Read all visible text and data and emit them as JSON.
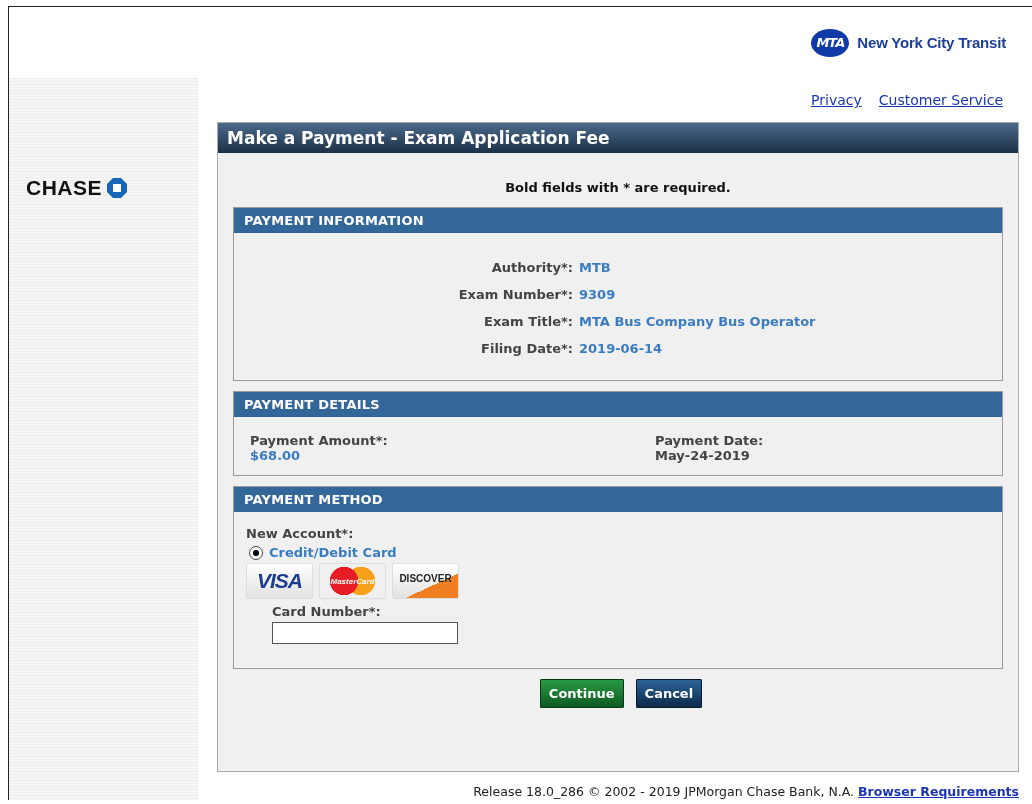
{
  "header": {
    "logo_mark": "MTA",
    "agency": "New York City Transit",
    "links": [
      "Privacy",
      "Customer Service"
    ]
  },
  "sidebar": {
    "logo": "CHASE"
  },
  "form": {
    "title": "Make a Payment - Exam Application Fee",
    "note": "Bold fields with * are required.",
    "sections": [
      {
        "kind": "fields",
        "title": "PAYMENT INFORMATION",
        "fields": [
          {
            "label": "Authority*:",
            "value": "MTB"
          },
          {
            "label": "Exam Number*:",
            "value": "9309"
          },
          {
            "label": "Exam Title*:",
            "value": "MTA Bus Company Bus Operator"
          },
          {
            "label": "Filing Date*:",
            "value": "2019-06-14"
          }
        ]
      },
      {
        "kind": "columns",
        "title": "PAYMENT DETAILS",
        "fields": [
          {
            "label": "Payment Amount*:",
            "value": "$68.00",
            "highlight": true
          },
          {
            "label": "Payment Date:",
            "value": "May-24-2019",
            "highlight": false
          }
        ]
      },
      {
        "kind": "method",
        "title": "PAYMENT METHOD",
        "label": "New Account*:",
        "options": [
          {
            "label": "Credit/Debit Card",
            "selected": true
          }
        ],
        "cards": [
          {
            "kind": "visa",
            "label": "VISA"
          },
          {
            "kind": "mastercard",
            "label": "MasterCard"
          },
          {
            "kind": "discover",
            "label": "DISCOVER"
          }
        ],
        "card_number": {
          "label": "Card Number*:"
        }
      }
    ],
    "buttons": [
      {
        "label": "Continue",
        "kind": "primary"
      },
      {
        "label": "Cancel",
        "kind": "secondary"
      }
    ]
  },
  "footer": {
    "text": "Release 18.0_286 © 2002 - 2019 JPMorgan Chase Bank, N.A.",
    "link": "Browser Requirements"
  }
}
